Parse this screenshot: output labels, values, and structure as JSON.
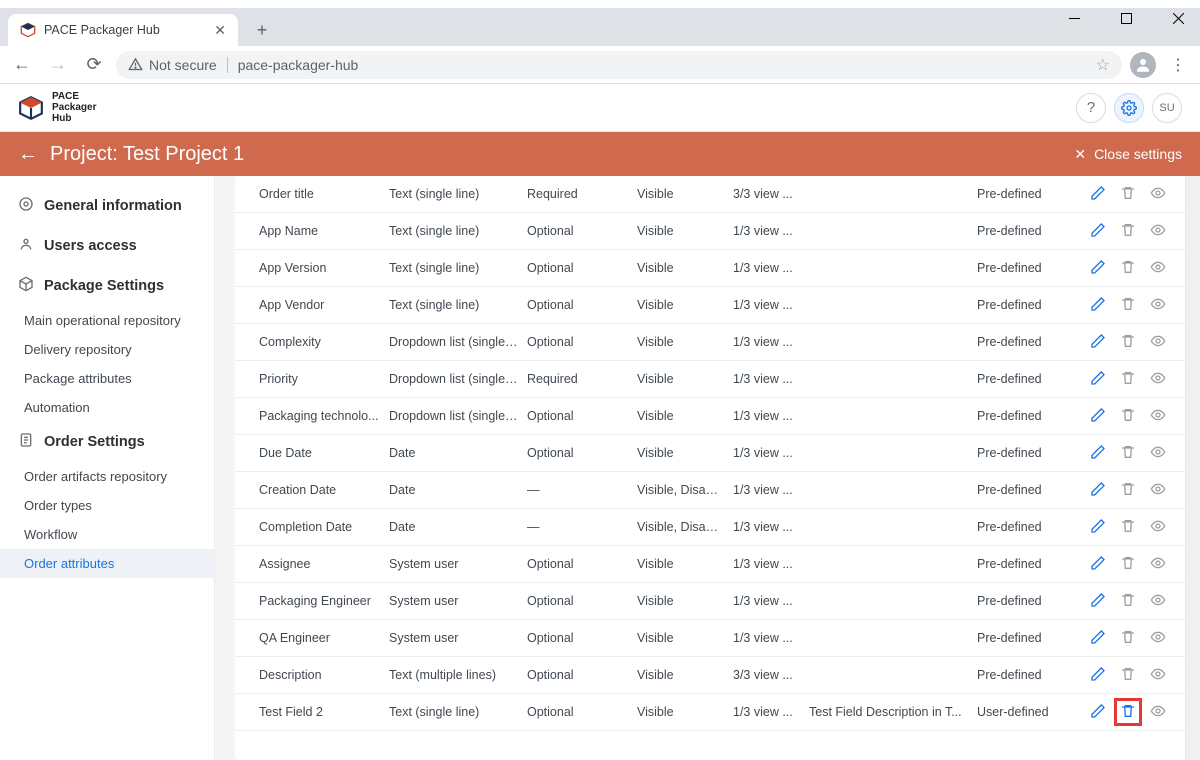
{
  "browser": {
    "tab_title": "PACE Packager Hub",
    "not_secure": "Not secure",
    "url": "pace-packager-hub"
  },
  "app": {
    "logo_lines": [
      "PACE",
      "Packager",
      "Hub"
    ],
    "avatar": "SU"
  },
  "header": {
    "title": "Project: Test Project 1",
    "close": "Close settings"
  },
  "sidebar": {
    "sections": [
      {
        "label": "General information"
      },
      {
        "label": "Users access"
      },
      {
        "label": "Package Settings",
        "items": [
          "Main operational repository",
          "Delivery repository",
          "Package attributes",
          "Automation"
        ]
      },
      {
        "label": "Order Settings",
        "items": [
          "Order artifacts repository",
          "Order types",
          "Workflow",
          "Order attributes"
        ]
      }
    ],
    "active": "Order attributes"
  },
  "table": {
    "rows": [
      {
        "name": "Order title",
        "type": "Text (single line)",
        "req": "Required",
        "vis": "Visible",
        "views": "3/3 view ...",
        "desc": "",
        "def": "Pre-defined",
        "hl": false
      },
      {
        "name": "App Name",
        "type": "Text (single line)",
        "req": "Optional",
        "vis": "Visible",
        "views": "1/3 view ...",
        "desc": "",
        "def": "Pre-defined",
        "hl": false
      },
      {
        "name": "App Version",
        "type": "Text (single line)",
        "req": "Optional",
        "vis": "Visible",
        "views": "1/3 view ...",
        "desc": "",
        "def": "Pre-defined",
        "hl": false
      },
      {
        "name": "App Vendor",
        "type": "Text (single line)",
        "req": "Optional",
        "vis": "Visible",
        "views": "1/3 view ...",
        "desc": "",
        "def": "Pre-defined",
        "hl": false
      },
      {
        "name": "Complexity",
        "type": "Dropdown list (single c...",
        "req": "Optional",
        "vis": "Visible",
        "views": "1/3 view ...",
        "desc": "",
        "def": "Pre-defined",
        "hl": false
      },
      {
        "name": "Priority",
        "type": "Dropdown list (single c...",
        "req": "Required",
        "vis": "Visible",
        "views": "1/3 view ...",
        "desc": "",
        "def": "Pre-defined",
        "hl": false
      },
      {
        "name": "Packaging technolo...",
        "type": "Dropdown list (single c...",
        "req": "Optional",
        "vis": "Visible",
        "views": "1/3 view ...",
        "desc": "",
        "def": "Pre-defined",
        "hl": false
      },
      {
        "name": "Due Date",
        "type": "Date",
        "req": "Optional",
        "vis": "Visible",
        "views": "1/3 view ...",
        "desc": "",
        "def": "Pre-defined",
        "hl": false
      },
      {
        "name": "Creation Date",
        "type": "Date",
        "req": "—",
        "vis": "Visible, Disabl...",
        "views": "1/3 view ...",
        "desc": "",
        "def": "Pre-defined",
        "hl": false
      },
      {
        "name": "Completion Date",
        "type": "Date",
        "req": "—",
        "vis": "Visible, Disabl...",
        "views": "1/3 view ...",
        "desc": "",
        "def": "Pre-defined",
        "hl": false
      },
      {
        "name": "Assignee",
        "type": "System user",
        "req": "Optional",
        "vis": "Visible",
        "views": "1/3 view ...",
        "desc": "",
        "def": "Pre-defined",
        "hl": false
      },
      {
        "name": "Packaging Engineer",
        "type": "System user",
        "req": "Optional",
        "vis": "Visible",
        "views": "1/3 view ...",
        "desc": "",
        "def": "Pre-defined",
        "hl": false
      },
      {
        "name": "QA Engineer",
        "type": "System user",
        "req": "Optional",
        "vis": "Visible",
        "views": "1/3 view ...",
        "desc": "",
        "def": "Pre-defined",
        "hl": false
      },
      {
        "name": "Description",
        "type": "Text (multiple lines)",
        "req": "Optional",
        "vis": "Visible",
        "views": "3/3 view ...",
        "desc": "",
        "def": "Pre-defined",
        "hl": false
      },
      {
        "name": "Test Field 2",
        "type": "Text (single line)",
        "req": "Optional",
        "vis": "Visible",
        "views": "1/3 view ...",
        "desc": "Test Field Description in T...",
        "def": "User-defined",
        "hl": true
      }
    ]
  }
}
